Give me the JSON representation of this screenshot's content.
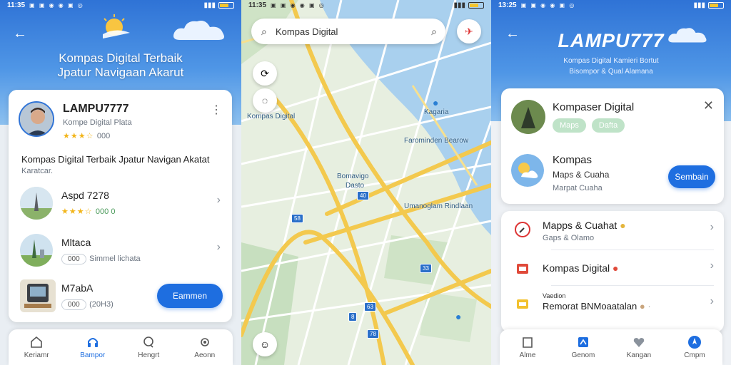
{
  "screen1": {
    "status_time": "11:35",
    "hero_title_line1": "Kompas Digital Terbaik",
    "hero_title_line2": "Jpatur Navigaan Akarut",
    "profile": {
      "name": "LAMPU7777",
      "subtitle": "Kompe Digital Plata",
      "rating_text": "000"
    },
    "description": "Kompas Digital Terbaik Jpatur Navigan Akatat",
    "description_sub": "Karatcar.",
    "list": [
      {
        "title": "Aspd 7278",
        "meta": "000 0"
      },
      {
        "title": "Mltaca",
        "chip": "000",
        "meta": "Simmel lichata"
      },
      {
        "title": "M7abA",
        "chip": "000",
        "meta": "(20H3)"
      }
    ],
    "action_button": "Eammen",
    "nav": [
      "Keriamr",
      "Bampor",
      "Hengrt",
      "Aeonn"
    ],
    "colors": {
      "primary": "#1e6ee0",
      "star": "#f2b51a"
    }
  },
  "screen2": {
    "search_text": "Kompas Digital",
    "labels": {
      "kompas_digital": "Kompas Digital",
      "kagaria": "Kagaria",
      "riverside": "Farominden Bearow",
      "center_top": "Bomavigo",
      "center_bottom": "Dasto",
      "river_lane": "Umanoglam Rindlaan",
      "shields": [
        "58",
        "40",
        "33",
        "8",
        "63",
        "78"
      ]
    }
  },
  "screen3": {
    "status_time": "13:25",
    "logo": "LAMPU777",
    "tagline1": "Kompas Digital Kamieri Bortut",
    "tagline2": "Bisompor & Qual Alamana",
    "card": {
      "title": "Kompaser Digital",
      "chips": [
        "Maps",
        "Dafta"
      ],
      "item_title": "Kompas",
      "item_sub": "Maps & Cuaha",
      "item_meta": "Marpat Cuaha",
      "button": "Sembain"
    },
    "list": [
      {
        "title": "Mapps & Cuahat",
        "sub": "Gaps & Olamo"
      },
      {
        "title": "Kompas Digital"
      },
      {
        "overline": "Vaedion",
        "title": "Remorat BNMoaatalan"
      }
    ],
    "nav": [
      "Alme",
      "Genom",
      "Kangan",
      "Cmpm"
    ]
  }
}
